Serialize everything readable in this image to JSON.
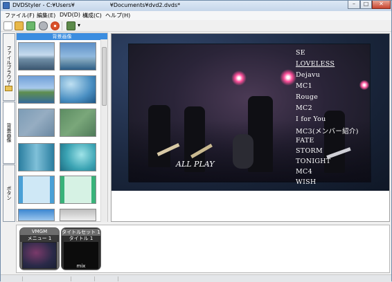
{
  "window": {
    "title": "DVDStyler - C:¥Users¥                    ¥Documents¥dvd2.dvds*",
    "minimize_glyph": "–",
    "maximize_glyph": "□",
    "close_glyph": "✕"
  },
  "menubar": {
    "items": [
      "ファイル(F)",
      "編集(E)",
      "DVD(D)",
      "構成(C)",
      "ヘルプ(H)"
    ]
  },
  "toolbar": {
    "icons": [
      "new-file-icon",
      "open-folder-icon",
      "add-file-icon",
      "settings-wrench-icon",
      "burn-disc-icon",
      "export-icon"
    ],
    "dropdown_glyph": "▾"
  },
  "side_tabs": [
    "ファイルブラウザー",
    "背景画像",
    "ボタン"
  ],
  "bg_panel": {
    "header": "背景画像",
    "thumbnails": [
      "sky-sea",
      "coast-sea",
      "bay-view",
      "blue-swirl",
      "blue-gray-texture",
      "green-texture",
      "teal-gradient",
      "teal-sparkle",
      "light-blue-frame",
      "green-frame",
      "blue-gradient",
      "gray-gradient"
    ]
  },
  "menu_preview": {
    "buttons": [
      "SE",
      "LOVELESS",
      "Dejavu",
      "MC1",
      "Rouge",
      "MC2",
      "I for You",
      "MC3(メンバー紹介)",
      "FATE",
      "STORM",
      "TONIGHT",
      "MC4",
      "WISH"
    ],
    "all_play": "ALL PLAY"
  },
  "titleset": {
    "items": [
      {
        "header": "VMGM",
        "subheader": "メニュー 1",
        "caption": ""
      },
      {
        "header": "タイトルセット 1",
        "subheader": "タイトル 1",
        "caption": "mix"
      }
    ]
  },
  "colors": {
    "panel_header": "#3b8de0",
    "preview_bg": "#1b2840",
    "stage_light": "#ff3d8a"
  }
}
